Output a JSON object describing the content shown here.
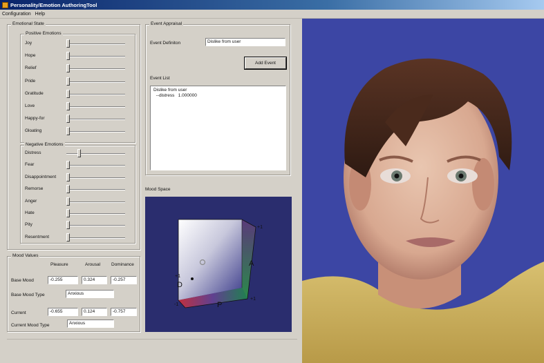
{
  "window": {
    "title": "Personality/Emotion AuthoringTool"
  },
  "menu": [
    "Configuration",
    "Help"
  ],
  "emotional_state": {
    "legend": "Emotional State",
    "positive": {
      "legend": "Positive Emotions",
      "items": [
        {
          "label": "Joy",
          "value": 0
        },
        {
          "label": "Hope",
          "value": 0
        },
        {
          "label": "Relief",
          "value": 0
        },
        {
          "label": "Pride",
          "value": 0
        },
        {
          "label": "Gratitude",
          "value": 0
        },
        {
          "label": "Love",
          "value": 0
        },
        {
          "label": "Happy-for",
          "value": 0
        },
        {
          "label": "Gloating",
          "value": 0
        }
      ]
    },
    "negative": {
      "legend": "Negative Emotions",
      "items": [
        {
          "label": "Distress",
          "value": 0.2
        },
        {
          "label": "Fear",
          "value": 0
        },
        {
          "label": "Disappointment",
          "value": 0
        },
        {
          "label": "Remorse",
          "value": 0
        },
        {
          "label": "Anger",
          "value": 0
        },
        {
          "label": "Hate",
          "value": 0
        },
        {
          "label": "Pity",
          "value": 0
        },
        {
          "label": "Resentment",
          "value": 0
        }
      ]
    }
  },
  "mood_values": {
    "legend": "Mood Values",
    "headers": [
      "Pleasure",
      "Arousal",
      "Dominance"
    ],
    "base_mood_label": "Base Mood",
    "base_mood": [
      "-0.255",
      "0.324",
      "-0.257"
    ],
    "base_mood_type_label": "Base Mood Type",
    "base_mood_type": "Anxious",
    "current_label": "Current",
    "current": [
      "-0.655",
      "0.124",
      "-0.757"
    ],
    "current_mood_type_label": "Current Mood Type",
    "current_mood_type": "Anxious"
  },
  "event_appraisal": {
    "legend": "Event Appraisal",
    "definition_label": "Event Definiton",
    "definition_value": "Dislike from user",
    "add_button": "Add Event",
    "list_label": "Event List",
    "list_lines": [
      "Dislike from user",
      "  --distress   1.000000"
    ]
  },
  "mood_space": {
    "label": "Mood Space",
    "axis_labels": {
      "a": "A",
      "p": "P",
      "d": "D",
      "plus1": "+1",
      "minus1": "-1"
    }
  },
  "colors": {
    "window_bg": "#d4d0c8",
    "title_blue": "#0a246a",
    "mood_space_bg": "#2a2d6e",
    "render_bg": "#3c46a4"
  }
}
